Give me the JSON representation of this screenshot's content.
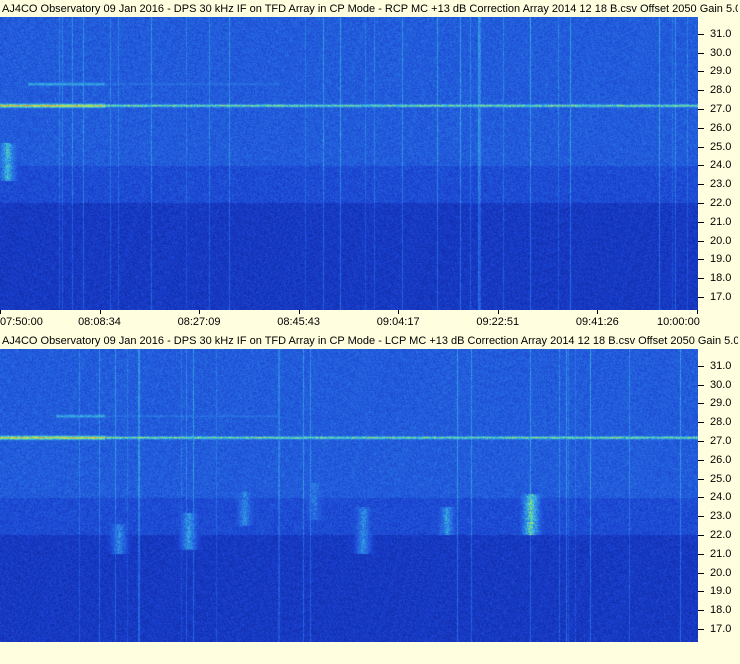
{
  "chart_data": [
    {
      "type": "heatmap",
      "title": "AJ4CO Observatory 09 Jan 2016 - DPS 30 kHz IF on TFD Array in CP Mode - RCP  MC +13 dB  Correction Array 2014 12 18 B.csv  Offset 2050  Gain 5.0",
      "x_ticks": [
        "07:50:00",
        "08:08:34",
        "08:27:09",
        "08:45:43",
        "09:04:17",
        "09:22:51",
        "09:41:26",
        "10:00:00"
      ],
      "y_ticks": [
        "17.0",
        "18.0",
        "19.0",
        "20.0",
        "21.0",
        "22.0",
        "23.0",
        "24.0",
        "25.0",
        "26.0",
        "27.0",
        "28.0",
        "29.0",
        "30.0",
        "31.0"
      ],
      "ylim": [
        16.3,
        31.9
      ],
      "colormap": [
        "#0a1e8c",
        "#1a40d0",
        "#2a78e6",
        "#3cc8d8",
        "#d0e840",
        "#ff4020"
      ],
      "features": [
        {
          "freq": 27.2,
          "intensity": 0.95,
          "extent": [
            0,
            1
          ]
        },
        {
          "freq": 28.35,
          "intensity": 0.6,
          "extent": [
            0.04,
            0.4
          ]
        }
      ],
      "bursts": [
        {
          "x": 0.01,
          "f0": 23.2,
          "f1": 25.2,
          "i": 0.7
        }
      ]
    },
    {
      "type": "heatmap",
      "title": "AJ4CO Observatory 09 Jan 2016 - DPS 30 kHz IF on TFD Array in CP Mode - LCP  MC +13 dB  Correction Array 2014 12 18 B.csv  Offset 2050  Gain 5.0",
      "x_ticks": [],
      "y_ticks": [
        "17.0",
        "18.0",
        "19.0",
        "20.0",
        "21.0",
        "22.0",
        "23.0",
        "24.0",
        "25.0",
        "26.0",
        "27.0",
        "28.0",
        "29.0",
        "30.0",
        "31.0"
      ],
      "ylim": [
        16.3,
        31.9
      ],
      "colormap": [
        "#0a1e8c",
        "#1a40d0",
        "#2a78e6",
        "#3cc8d8",
        "#d0e840",
        "#ff4020"
      ],
      "features": [
        {
          "freq": 27.2,
          "intensity": 0.95,
          "extent": [
            0,
            1
          ]
        },
        {
          "freq": 28.35,
          "intensity": 0.6,
          "extent": [
            0.08,
            0.4
          ]
        }
      ],
      "bursts": [
        {
          "x": 0.17,
          "f0": 21.0,
          "f1": 22.6,
          "i": 0.55
        },
        {
          "x": 0.27,
          "f0": 21.2,
          "f1": 23.2,
          "i": 0.6
        },
        {
          "x": 0.35,
          "f0": 22.5,
          "f1": 24.3,
          "i": 0.55
        },
        {
          "x": 0.45,
          "f0": 22.8,
          "f1": 24.8,
          "i": 0.5
        },
        {
          "x": 0.52,
          "f0": 21.0,
          "f1": 23.5,
          "i": 0.55
        },
        {
          "x": 0.64,
          "f0": 22.0,
          "f1": 23.5,
          "i": 0.6
        },
        {
          "x": 0.76,
          "f0": 22.0,
          "f1": 24.2,
          "i": 0.8
        }
      ]
    }
  ]
}
